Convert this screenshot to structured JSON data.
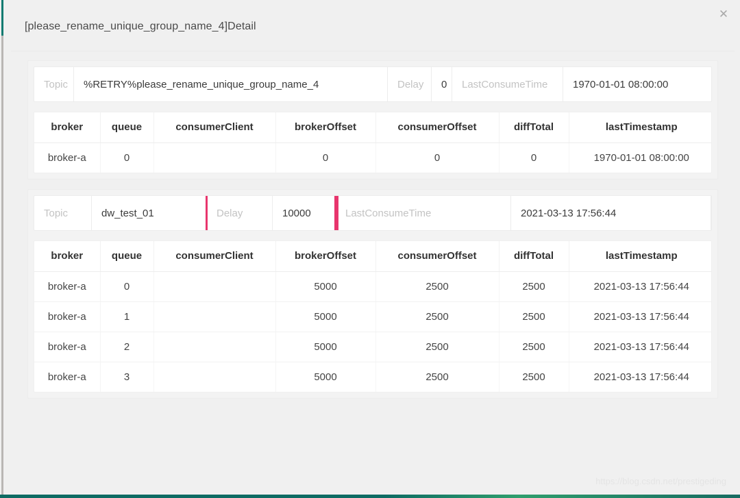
{
  "window": {
    "close_icon": "close-icon",
    "close_label": "✕"
  },
  "modal": {
    "title": "[please_rename_unique_group_name_4]Detail"
  },
  "accent_colors": {
    "highlight": "#e8356d",
    "page_accent": "#0c7a70",
    "label_gray": "#c3c3c3",
    "text": "#3b3b3b"
  },
  "sections": [
    {
      "id": "retry-topic-section",
      "descriptions": [
        {
          "label": "Topic",
          "value": "%RETRY%please_rename_unique_group_name_4"
        },
        {
          "label": "Delay",
          "value": "0"
        },
        {
          "label": "LastConsumeTime",
          "value": "1970-01-01 08:00:00"
        }
      ],
      "table": {
        "columns": [
          "broker",
          "queue",
          "consumerClient",
          "brokerOffset",
          "consumerOffset",
          "diffTotal",
          "lastTimestamp"
        ],
        "rows": [
          [
            "broker-a",
            "0",
            "",
            "0",
            "0",
            "0",
            "1970-01-01 08:00:00"
          ]
        ]
      }
    },
    {
      "id": "dw-test-topic-section",
      "descriptions": [
        {
          "label": "Topic",
          "value": "dw_test_01"
        },
        {
          "label": "Delay",
          "value": "10000"
        },
        {
          "label": "LastConsumeTime",
          "value": "2021-03-13 17:56:44"
        }
      ],
      "table": {
        "columns": [
          "broker",
          "queue",
          "consumerClient",
          "brokerOffset",
          "consumerOffset",
          "diffTotal",
          "lastTimestamp"
        ],
        "rows": [
          [
            "broker-a",
            "0",
            "",
            "5000",
            "2500",
            "2500",
            "2021-03-13 17:56:44"
          ],
          [
            "broker-a",
            "1",
            "",
            "5000",
            "2500",
            "2500",
            "2021-03-13 17:56:44"
          ],
          [
            "broker-a",
            "2",
            "",
            "5000",
            "2500",
            "2500",
            "2021-03-13 17:56:44"
          ],
          [
            "broker-a",
            "3",
            "",
            "5000",
            "2500",
            "2500",
            "2021-03-13 17:56:44"
          ]
        ]
      }
    }
  ],
  "watermark": "https://blog.csdn.net/prestigeding"
}
